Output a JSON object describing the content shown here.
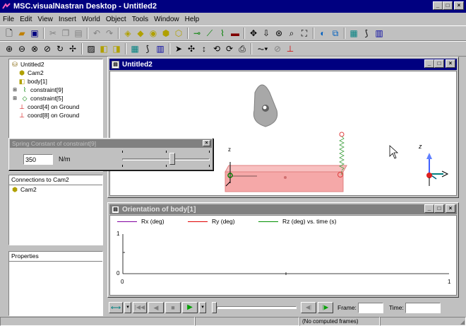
{
  "app": {
    "title": "MSC.visualNastran Desktop - Untitled2"
  },
  "menu": [
    "File",
    "Edit",
    "View",
    "Insert",
    "World",
    "Object",
    "Tools",
    "Window",
    "Help"
  ],
  "tree": {
    "items": [
      {
        "label": "Untitled2"
      },
      {
        "label": "Cam2"
      },
      {
        "label": "body[1]"
      },
      {
        "label": "constraint[9]"
      },
      {
        "label": "constraint[5]"
      },
      {
        "label": "coord[4] on Ground"
      },
      {
        "label": "coord[8] on Ground"
      }
    ]
  },
  "spring_dialog": {
    "title": "Spring Constant of constraint[9]",
    "value": "350",
    "unit": "N/m",
    "slider_level": 0.58
  },
  "connections": {
    "header": "Connections to Cam2",
    "items": [
      "Cam2"
    ]
  },
  "properties": {
    "header": "Properties"
  },
  "viewport": {
    "title": "Untitled2",
    "axis_z": "z",
    "triad_z": "z"
  },
  "plot_window": {
    "title": "Orientation of body[1]",
    "legend": [
      {
        "label": "Rx (deg)",
        "color": "#8000a0"
      },
      {
        "label": "Ry (deg)",
        "color": "#e00000"
      },
      {
        "label": "Rz (deg)  vs. time (s)",
        "color": "#009000"
      }
    ],
    "chart_data": {
      "type": "line",
      "series": [],
      "ylim": [
        0,
        1
      ],
      "xlim": [
        0,
        1
      ],
      "y_ticks": [
        "1",
        "0"
      ],
      "x_ticks": [
        "0",
        "1"
      ]
    }
  },
  "playback": {
    "frame_label": "Frame:",
    "time_label": "Time:",
    "frame_value": "",
    "time_value": ""
  },
  "status": {
    "computed": "(No computed frames)"
  }
}
